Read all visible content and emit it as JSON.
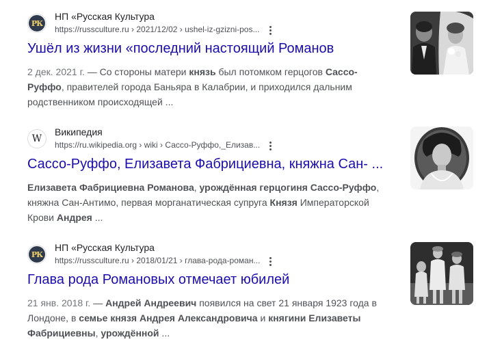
{
  "results": [
    {
      "site_name": "НП «Русская Культура",
      "url_host": "https://russculture.ru",
      "url_path": " › 2021/12/02 › ushel-iz-gzizni-pos...",
      "title": "Ушёл из жизни «последний настоящий Романов",
      "date": "2 дек. 2021 г.",
      "snippet": [
        {
          "t": " — Со стороны матери ",
          "b": false
        },
        {
          "t": "князь",
          "b": true
        },
        {
          "t": " был потомком герцогов ",
          "b": false
        },
        {
          "t": "Сассо-Руффо",
          "b": true
        },
        {
          "t": ", правителей города Баньяра в Калабрии, и приходился дальним родственником происходящей ...",
          "b": false
        }
      ],
      "favicon_icon": "rk-logo-icon",
      "favicon_text": "РК"
    },
    {
      "site_name": "Википедия",
      "url_host": "https://ru.wikipedia.org",
      "url_path": " › wiki › Сассо-Руффо,_Елизав...",
      "title": "Сассо-Руффо, Елизавета Фабрициевна, княжна Сан- ...",
      "date": "",
      "snippet": [
        {
          "t": "Елизавета Фабрициевна Романова",
          "b": true
        },
        {
          "t": ", ",
          "b": false
        },
        {
          "t": "урождённая герцогиня Сассо-Руффо",
          "b": true
        },
        {
          "t": ", княжна Сан-Антимо, первая морганатическая супруга ",
          "b": false
        },
        {
          "t": "Князя",
          "b": true
        },
        {
          "t": " Императорской Крови ",
          "b": false
        },
        {
          "t": "Андрея",
          "b": true
        },
        {
          "t": " ...",
          "b": false
        }
      ],
      "favicon_icon": "wikipedia-icon",
      "favicon_text": "W"
    },
    {
      "site_name": "НП «Русская Культура",
      "url_host": "https://russculture.ru",
      "url_path": " › 2018/01/21 › глава-рода-роман...",
      "title": "Глава рода Романовых отмечает юбилей",
      "date": "21 янв. 2018 г.",
      "snippet": [
        {
          "t": " — ",
          "b": false
        },
        {
          "t": "Андрей Андреевич",
          "b": true
        },
        {
          "t": " появился на свет 21 января 1923 года в Лондоне, в ",
          "b": false
        },
        {
          "t": "семье князя Андрея Александровича",
          "b": true
        },
        {
          "t": " и ",
          "b": false
        },
        {
          "t": "княгини Елизаветы Фабрициевны",
          "b": true
        },
        {
          "t": ", ",
          "b": false
        },
        {
          "t": "урождённой",
          "b": true
        },
        {
          "t": " ...",
          "b": false
        }
      ],
      "favicon_icon": "rk-logo-icon",
      "favicon_text": "РК"
    }
  ],
  "thumbnails": [
    "wedding-photo-thumbnail",
    "portrait-photo-thumbnail",
    "children-photo-thumbnail"
  ],
  "colors": {
    "link": "#1a0dab",
    "text": "#4d5156",
    "site": "#202124"
  }
}
